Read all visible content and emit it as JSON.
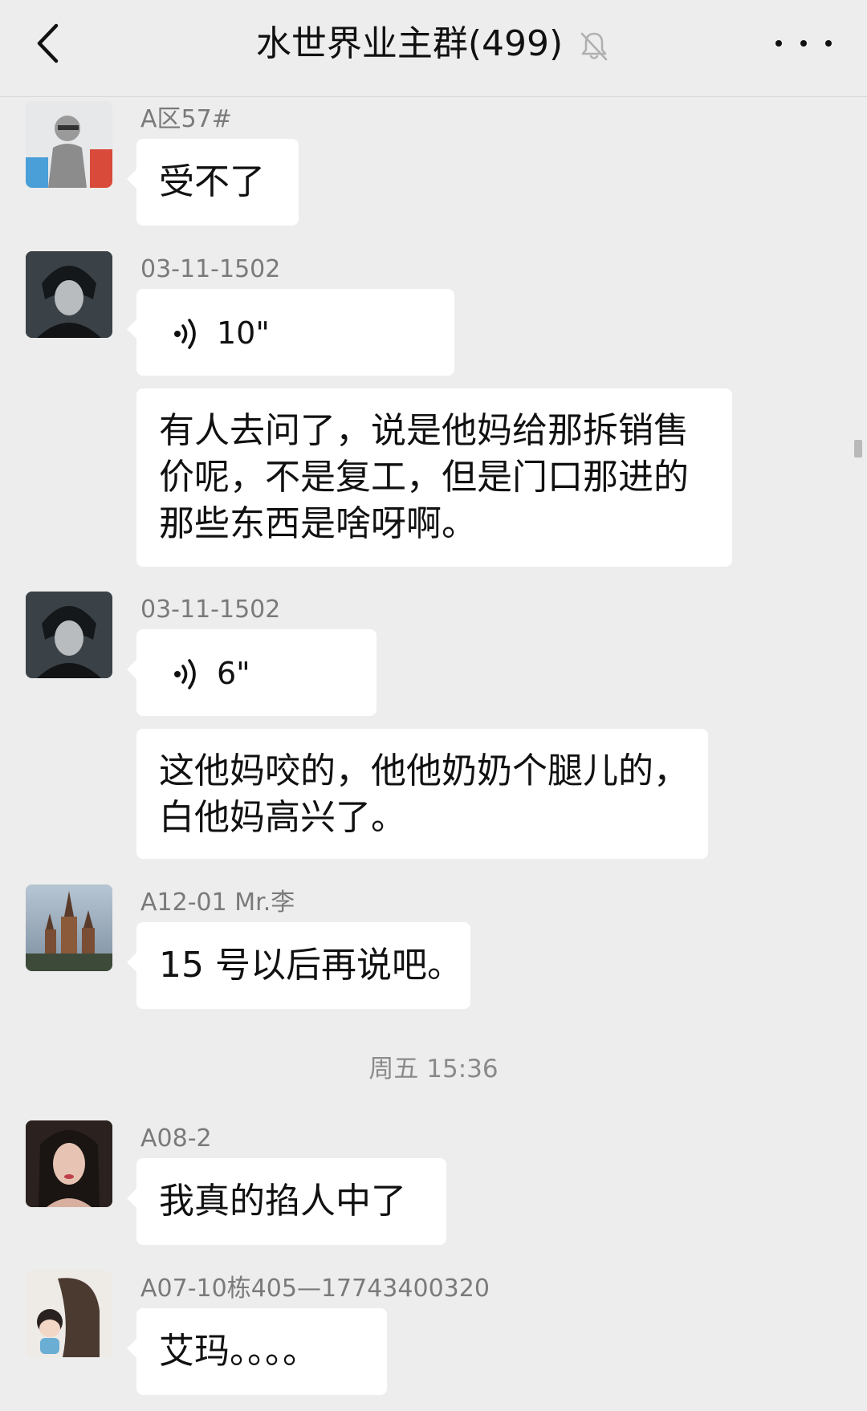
{
  "header": {
    "title": "水世界业主群(499)",
    "back_icon": "chevron-left-icon",
    "mute_icon": "bell-off-icon",
    "more_icon": "ellipsis-icon"
  },
  "messages": [
    {
      "sender": "A区57#",
      "type": "text",
      "text": "受不了"
    },
    {
      "sender": "03-11-1502",
      "type": "voice",
      "duration": "10\""
    },
    {
      "sender": "03-11-1502",
      "type": "text",
      "text": "有人去问了，说是他妈给那拆销售价呢，不是复工，但是门口那进的那些东西是啥呀啊。"
    },
    {
      "sender": "03-11-1502",
      "type": "voice",
      "duration": "6\""
    },
    {
      "sender": "03-11-1502",
      "type": "text",
      "text": "这他妈咬的，他他奶奶个腿儿的，白他妈高兴了。"
    },
    {
      "sender": "A12-01 Mr.李",
      "type": "text",
      "text": "15 号以后再说吧。"
    },
    {
      "sender": "A08-2",
      "type": "text",
      "text": "我真的掐人中了"
    },
    {
      "sender": "A07-10栋405—17743400320",
      "type": "text",
      "text": "艾玛。。。。"
    }
  ],
  "time_separator": "周五 15:36",
  "colors": {
    "background": "#ededed",
    "bubble": "#ffffff",
    "name": "#7a7a7a"
  }
}
